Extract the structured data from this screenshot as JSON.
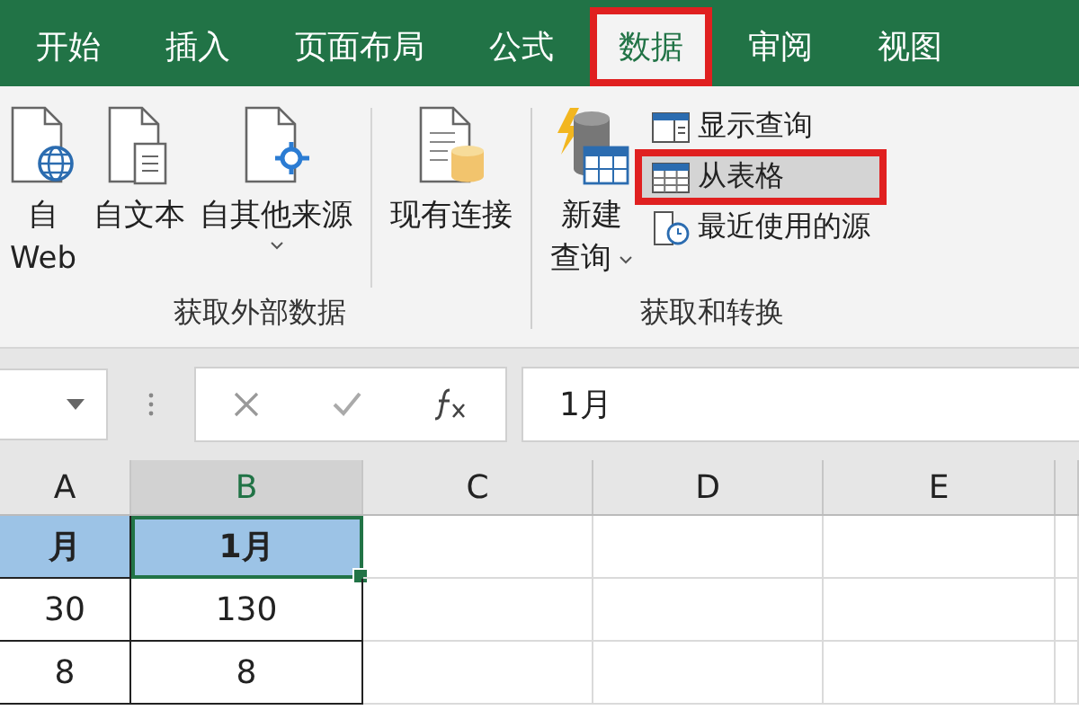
{
  "tabs": [
    {
      "label": "开始",
      "selected": false,
      "marked": false
    },
    {
      "label": "插入",
      "selected": false,
      "marked": false
    },
    {
      "label": "页面布局",
      "selected": false,
      "marked": false
    },
    {
      "label": "公式",
      "selected": false,
      "marked": false
    },
    {
      "label": "数据",
      "selected": true,
      "marked": true
    },
    {
      "label": "审阅",
      "selected": false,
      "marked": false
    },
    {
      "label": "视图",
      "selected": false,
      "marked": false
    }
  ],
  "ribbon": {
    "groups": [
      {
        "label": "获取外部数据",
        "items": [
          {
            "kind": "large",
            "lines": [
              "自",
              "Web"
            ],
            "dropdown": false
          },
          {
            "kind": "large",
            "lines": [
              "自文本"
            ],
            "dropdown": false
          },
          {
            "kind": "large",
            "lines": [
              "自其他来源"
            ],
            "dropdown": true
          },
          {
            "kind": "separator"
          },
          {
            "kind": "large",
            "lines": [
              "现有连接"
            ],
            "dropdown": false
          }
        ]
      },
      {
        "label": "获取和转换",
        "items": [
          {
            "kind": "large",
            "lines": [
              "新建",
              "查询"
            ],
            "dropdown": true
          },
          {
            "kind": "stack",
            "entries": [
              {
                "label": "显示查询",
                "selected": false,
                "marked": false
              },
              {
                "label": "从表格",
                "selected": true,
                "marked": true
              },
              {
                "label": "最近使用的源",
                "selected": false,
                "marked": false
              }
            ]
          }
        ]
      }
    ]
  },
  "formula_bar": {
    "value": "1月"
  },
  "sheet": {
    "columns": [
      {
        "label": "A",
        "selected": false
      },
      {
        "label": "B",
        "selected": true
      },
      {
        "label": "C",
        "selected": false
      },
      {
        "label": "D",
        "selected": false
      },
      {
        "label": "E",
        "selected": false
      }
    ],
    "rows": [
      {
        "cells": [
          {
            "text": "月",
            "selected": true,
            "active": false,
            "bold": true
          },
          {
            "text": "1月",
            "selected": true,
            "active": true,
            "bold": true
          }
        ]
      },
      {
        "cells": [
          {
            "text": "30",
            "selected": false,
            "active": false,
            "bold": false
          },
          {
            "text": "130",
            "selected": false,
            "active": false,
            "bold": false
          }
        ]
      },
      {
        "cells": [
          {
            "text": "8",
            "selected": false,
            "active": false,
            "bold": false
          },
          {
            "text": "8",
            "selected": false,
            "active": false,
            "bold": false
          }
        ]
      }
    ]
  }
}
